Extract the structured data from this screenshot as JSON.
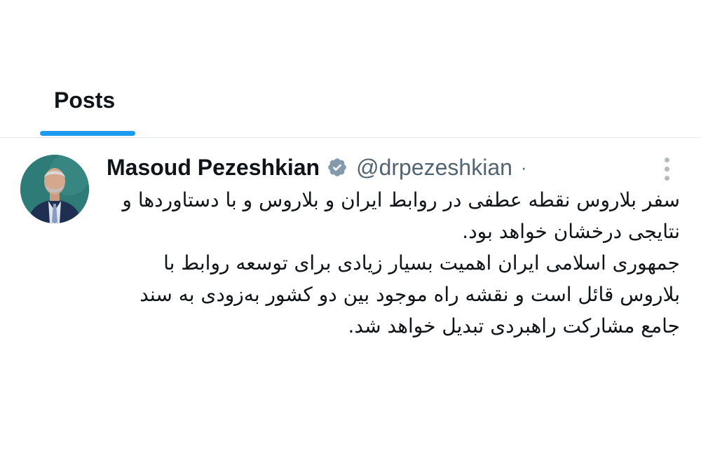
{
  "tabs": {
    "posts_label": "Posts"
  },
  "post": {
    "display_name": "Masoud Pezeshkian",
    "handle": "@drpezeshkian",
    "separator": "·",
    "verified": true,
    "verified_badge_icon": "verified-badge-icon",
    "more_icon": "more-vertical-icon",
    "paragraphs": [
      "سفر بلاروس نقطه عطفی در روابط ایران و بلاروس و با دستاوردها و نتایجی درخشان خواهد بود.",
      "جمهوری اسلامی ایران اهمیت بسیار زیادی برای توسعه روابط با بلاروس قائل است و نقشه راه موجود بین دو کشور به‌زودی به سند جامع مشارکت راهبردی تبدیل خواهد شد."
    ]
  },
  "colors": {
    "accent": "#1d9bf0",
    "text": "#0f1419",
    "secondary_text": "#536471",
    "divider": "#e4e9ec",
    "avatar_background": "#2e7b78"
  }
}
